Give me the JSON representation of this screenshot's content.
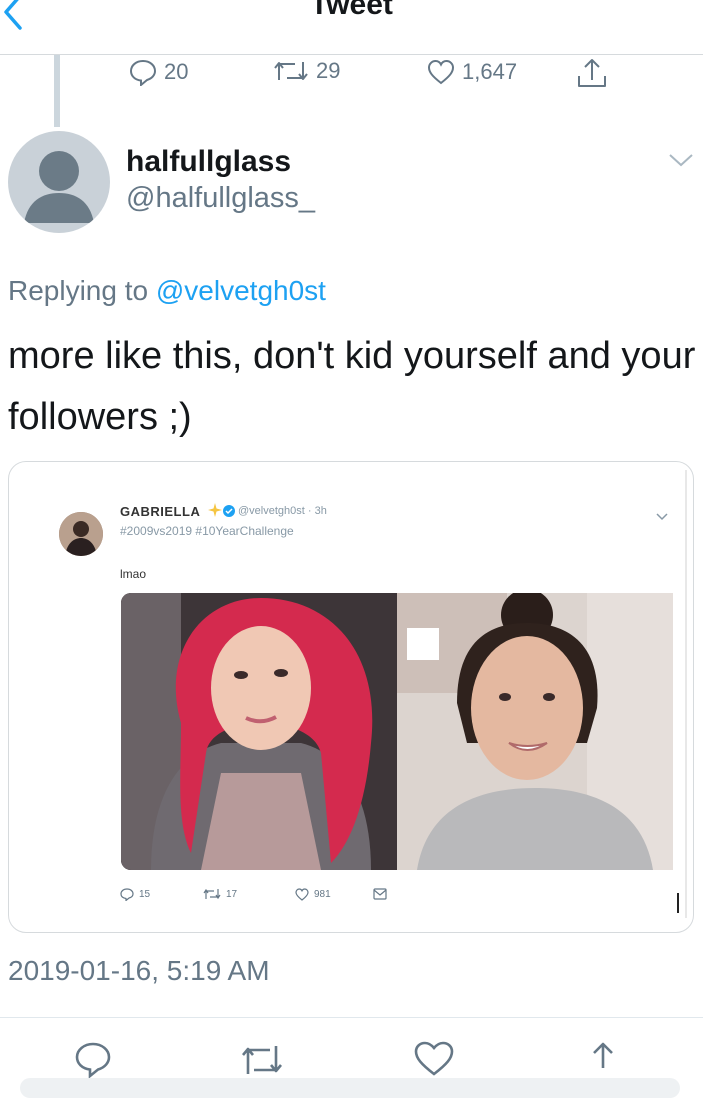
{
  "header": {
    "title": "Tweet"
  },
  "parent_stats": {
    "replies": "20",
    "retweets": "29",
    "likes": "1,647"
  },
  "user": {
    "display_name": "halfullglass",
    "handle": "@halfullglass_"
  },
  "reply": {
    "prefix": "Replying to",
    "to": "@velvetgh0st"
  },
  "tweet": {
    "text": "more like this, don't kid yourself and your followers ;)"
  },
  "embedded": {
    "name": "GABRIELLA",
    "meta": "@velvetgh0st · 3h",
    "hashtags": "#2009vs2019 #10YearChallenge",
    "text": "lmao",
    "replies": "15",
    "retweets": "17",
    "likes": "981"
  },
  "timestamp": "2019-01-16, 5:19 AM",
  "colors": {
    "accent": "#1da1f2",
    "secondary_text": "#657786",
    "divider": "#d6dadd"
  },
  "icons": [
    "back-icon",
    "reply-icon",
    "retweet-icon",
    "like-icon",
    "share-icon",
    "chevron-down-icon",
    "verified-icon",
    "star-icon",
    "avatar-placeholder-icon"
  ]
}
